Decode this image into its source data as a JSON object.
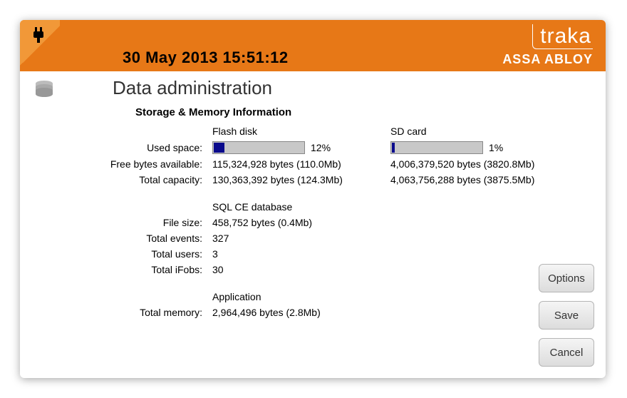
{
  "header": {
    "datetime": "30 May 2013  15:51:12",
    "brand_main": "traka",
    "brand_sub": "ASSA ABLOY"
  },
  "page": {
    "title": "Data administration",
    "subtitle": "Storage & Memory Information"
  },
  "storage": {
    "col_flash": "Flash disk",
    "col_sd": "SD card",
    "used_label": "Used space:",
    "free_label": "Free bytes available:",
    "total_label": "Total capacity:",
    "flash": {
      "used_pct": "12%",
      "used_width": "12%",
      "free": "115,324,928 bytes (110.0Mb)",
      "total": "130,363,392 bytes (124.3Mb)"
    },
    "sd": {
      "used_pct": "1%",
      "used_width": "2%",
      "free": "4,006,379,520 bytes (3820.8Mb)",
      "total": "4,063,756,288 bytes (3875.5Mb)"
    }
  },
  "db": {
    "heading": "SQL CE database",
    "file_label": "File size:",
    "file_val": "458,752 bytes (0.4Mb)",
    "events_label": "Total events:",
    "events_val": "327",
    "users_label": "Total users:",
    "users_val": "3",
    "ifobs_label": "Total iFobs:",
    "ifobs_val": "30"
  },
  "app": {
    "heading": "Application",
    "mem_label": "Total memory:",
    "mem_val": "2,964,496 bytes (2.8Mb)"
  },
  "buttons": {
    "options": "Options",
    "save": "Save",
    "cancel": "Cancel"
  }
}
